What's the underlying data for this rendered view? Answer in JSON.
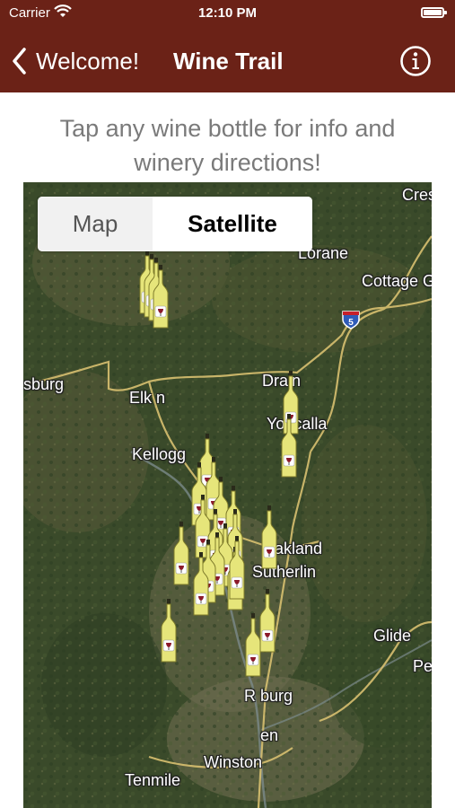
{
  "status_bar": {
    "carrier": "Carrier",
    "time": "12:10 PM"
  },
  "nav": {
    "back_label": "Welcome!",
    "title": "Wine Trail",
    "bar_color": "#6b2217"
  },
  "instruction": {
    "line1": "Tap any wine bottle for info and",
    "line2": "winery directions!"
  },
  "map_type": {
    "options": [
      "Map",
      "Satellite"
    ],
    "selected": "Satellite"
  },
  "map_labels": {
    "cres": "Cres",
    "lorane": "Lorane",
    "cottage_grove": "Cottage G",
    "interstate": "5",
    "sburg": "sburg",
    "elkton": "Elk   n",
    "drain": "Drain",
    "yoncalla": "Yoncalla",
    "kellogg": "Kellogg",
    "oakland": "Oakland",
    "sutherlin": "Sutherlin",
    "glide": "Glide",
    "pe": "Pe",
    "roseburg": "R     burg",
    "green": "en",
    "winston": "Winston",
    "tenmile": "Tenmile"
  },
  "wineries": [
    {
      "id": 1
    },
    {
      "id": 2
    },
    {
      "id": 3
    },
    {
      "id": 4
    },
    {
      "id": 5
    },
    {
      "id": 6
    },
    {
      "id": 7
    },
    {
      "id": 8
    },
    {
      "id": 9
    },
    {
      "id": 10
    },
    {
      "id": 11
    },
    {
      "id": 12
    },
    {
      "id": 13
    },
    {
      "id": 14
    },
    {
      "id": 15
    },
    {
      "id": 16
    },
    {
      "id": 17
    },
    {
      "id": 18
    },
    {
      "id": 19
    },
    {
      "id": 20
    },
    {
      "id": 21
    },
    {
      "id": 22
    },
    {
      "id": 23
    },
    {
      "id": 24
    },
    {
      "id": 25
    }
  ]
}
